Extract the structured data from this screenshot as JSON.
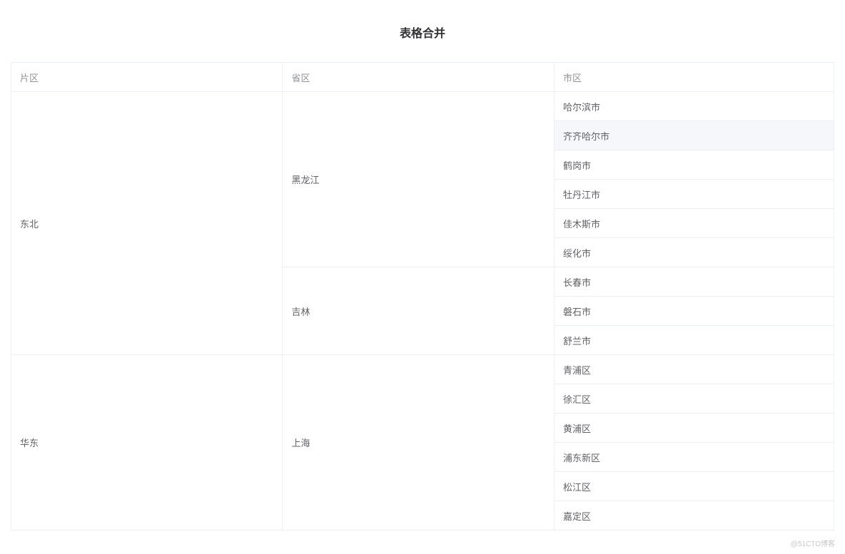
{
  "title": "表格合并",
  "columns": [
    {
      "key": "region",
      "label": "片区"
    },
    {
      "key": "province",
      "label": "省区"
    },
    {
      "key": "city",
      "label": "市区"
    }
  ],
  "rows": [
    {
      "region": "东北",
      "province": "黑龙江",
      "city": "哈尔滨市"
    },
    {
      "region": "东北",
      "province": "黑龙江",
      "city": "齐齐哈尔市"
    },
    {
      "region": "东北",
      "province": "黑龙江",
      "city": "鹤岗市"
    },
    {
      "region": "东北",
      "province": "黑龙江",
      "city": "牡丹江市"
    },
    {
      "region": "东北",
      "province": "黑龙江",
      "city": "佳木斯市"
    },
    {
      "region": "东北",
      "province": "黑龙江",
      "city": "绥化市"
    },
    {
      "region": "东北",
      "province": "吉林",
      "city": "长春市"
    },
    {
      "region": "东北",
      "province": "吉林",
      "city": "磐石市"
    },
    {
      "region": "东北",
      "province": "吉林",
      "city": "舒兰市"
    },
    {
      "region": "华东",
      "province": "上海",
      "city": "青浦区"
    },
    {
      "region": "华东",
      "province": "上海",
      "city": "徐汇区"
    },
    {
      "region": "华东",
      "province": "上海",
      "city": "黄浦区"
    },
    {
      "region": "华东",
      "province": "上海",
      "city": "浦东新区"
    },
    {
      "region": "华东",
      "province": "上海",
      "city": "松江区"
    },
    {
      "region": "华东",
      "province": "上海",
      "city": "嘉定区"
    }
  ],
  "hoverRowIndex": 1,
  "watermark": "@51CTO博客"
}
